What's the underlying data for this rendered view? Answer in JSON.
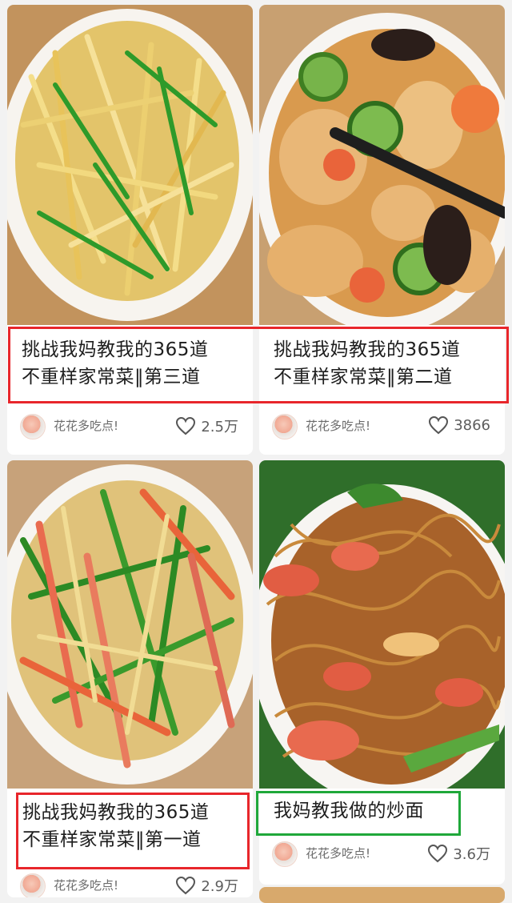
{
  "feed": {
    "cards": [
      {
        "title_line1": "挑战我妈教我的365道",
        "title_line2": "不重样家常菜‖第三道",
        "author": "花花多吃点!",
        "likes": "2.5万",
        "box_color": "#e8262b"
      },
      {
        "title_line1": "挑战我妈教我的365道",
        "title_line2": "不重样家常菜‖第二道",
        "author": "花花多吃点!",
        "likes": "3866",
        "box_color": "#e8262b"
      },
      {
        "title_line1": "挑战我妈教我的365道",
        "title_line2": "不重样家常菜‖第一道",
        "author": "花花多吃点!",
        "likes": "2.9万",
        "box_color": "#e8262b"
      },
      {
        "title_line1": "我妈教我做的炒面",
        "author": "花花多吃点!",
        "likes": "3.6万",
        "box_color": "#1fa83a"
      }
    ]
  },
  "icons": {
    "like": "heart-outline-icon",
    "avatar": "author-avatar"
  }
}
